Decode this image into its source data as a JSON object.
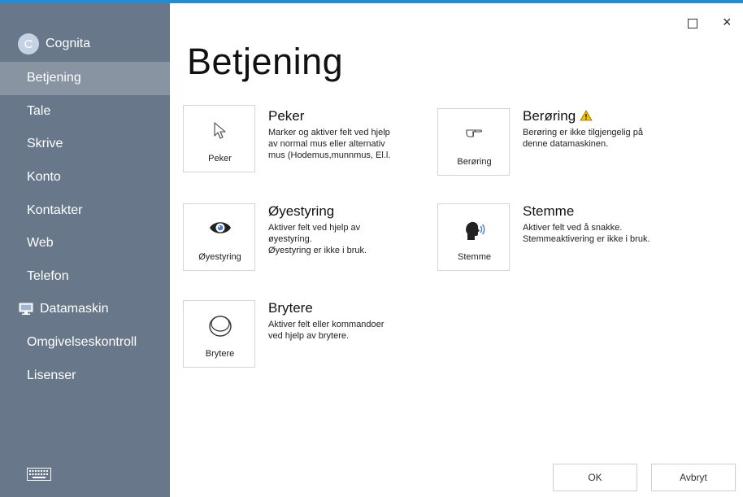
{
  "user": {
    "initial": "C",
    "name": "Cognita"
  },
  "sidebar": {
    "items": [
      {
        "label": "Betjening",
        "active": true
      },
      {
        "label": "Tale"
      },
      {
        "label": "Skrive"
      },
      {
        "label": "Konto"
      },
      {
        "label": "Kontakter"
      },
      {
        "label": "Web"
      },
      {
        "label": "Telefon"
      },
      {
        "label": "Datamaskin",
        "icon": "monitor-icon"
      },
      {
        "label": "Omgivelseskontroll"
      },
      {
        "label": "Lisenser"
      }
    ],
    "bottom_icon": "keyboard-icon"
  },
  "window": {
    "maximize_icon": "maximize-icon",
    "close_label": "×"
  },
  "page": {
    "title": "Betjening"
  },
  "features": [
    {
      "tile_label": "Peker",
      "icon": "pointer-icon",
      "title": "Peker",
      "lines": [
        "Marker og aktiver felt ved hjelp",
        "av normal mus eller alternativ",
        "mus (Hodemus,munnmus, El.l."
      ]
    },
    {
      "tile_label": "Berøring",
      "icon": "touch-hand-icon",
      "title": "Berøring",
      "warning_icon": "warning-icon",
      "lines": [
        "Berøring er ikke tilgjengelig på",
        "denne datamaskinen."
      ]
    },
    {
      "tile_label": "Øyestyring",
      "icon": "eye-icon",
      "title": "Øyestyring",
      "lines": [
        "Aktiver felt ved hjelp av",
        "øyestyring.",
        "Øyestyring er ikke i bruk."
      ]
    },
    {
      "tile_label": "Stemme",
      "icon": "voice-icon",
      "title": "Stemme",
      "lines": [
        "Aktiver felt ved å snakke.",
        "Stemmeaktivering er ikke i bruk."
      ]
    },
    {
      "tile_label": "Brytere",
      "icon": "switch-button-icon",
      "title": "Brytere",
      "lines": [
        "Aktiver felt eller kommandoer",
        "ved hjelp av brytere."
      ]
    }
  ],
  "buttons": {
    "ok": "OK",
    "cancel": "Avbryt"
  },
  "colors": {
    "sidebar": "#68788a",
    "sidebar_active": "#8894a2",
    "accent": "#1e8fd6",
    "warning": "#f2c300"
  }
}
